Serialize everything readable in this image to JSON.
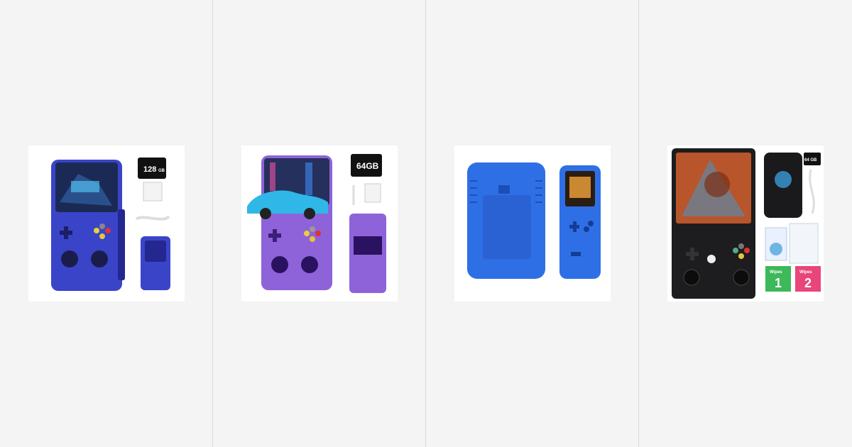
{
  "products": [
    {
      "card_name": "product-card-blue-transparent-handheld",
      "sd_card_label": "128",
      "sd_card_unit": "GB",
      "colors": {
        "body": "#3a44c8",
        "body_dark": "#23278f",
        "screen": "#1b2a55",
        "accent": "#5ad1ff"
      }
    },
    {
      "card_name": "product-card-purple-transparent-handheld",
      "sd_card_label": "64GB",
      "colors": {
        "body": "#8e63d9",
        "body_dark": "#5b2fb0",
        "screen": "#26305c",
        "accent": "#2fb7e8"
      }
    },
    {
      "card_name": "product-card-blue-retro-handheld",
      "colors": {
        "body": "#2f6fe6",
        "body_dark": "#1b4fb8",
        "screen": "#2a1d12",
        "accent": "#f2a43a"
      }
    },
    {
      "card_name": "product-card-black-handheld-bundle",
      "sd_card_label": "64 GB",
      "wipes_1": "1",
      "wipes_2": "2",
      "wipes_label": "Wipes",
      "colors": {
        "body": "#1d1d1f",
        "body_dark": "#0c0c0d",
        "screen": "#b8552a",
        "accent": "#3a9bd8"
      }
    }
  ]
}
